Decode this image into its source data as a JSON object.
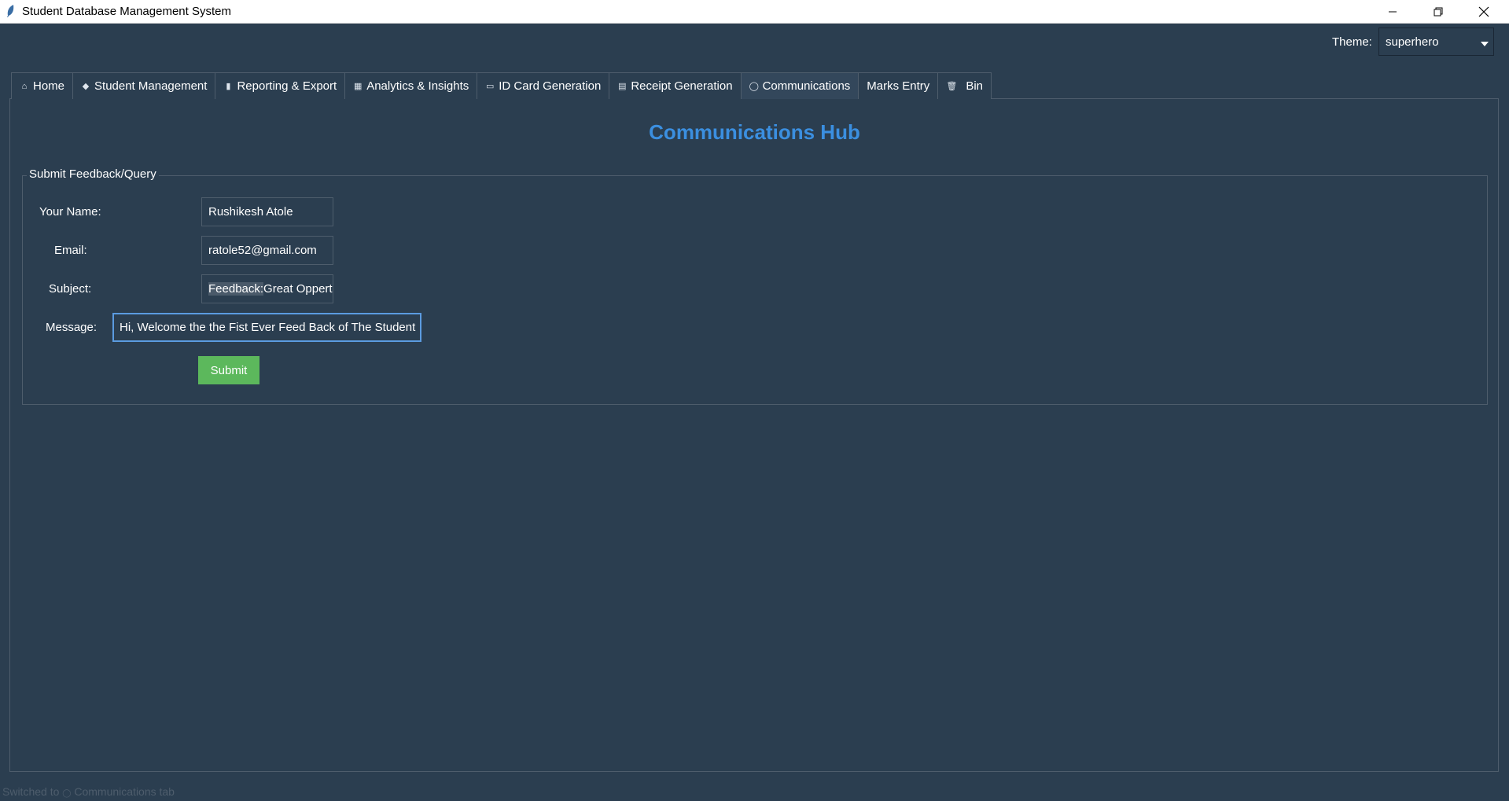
{
  "window": {
    "title": "Student Database Management System",
    "app_icon": "feather-icon"
  },
  "theme": {
    "label": "Theme:",
    "selected": "superhero"
  },
  "tabs": [
    {
      "icon": "⌂",
      "icon_name": "home-icon",
      "label": "Home"
    },
    {
      "icon": "◆",
      "icon_name": "graduation-cap-icon",
      "label": "Student Management"
    },
    {
      "icon": "▮",
      "icon_name": "chart-icon",
      "label": "Reporting & Export"
    },
    {
      "icon": "▦",
      "icon_name": "analytics-icon",
      "label": "Analytics & Insights"
    },
    {
      "icon": "▭",
      "icon_name": "id-card-icon",
      "label": "ID Card Generation"
    },
    {
      "icon": "▤",
      "icon_name": "receipt-icon",
      "label": "Receipt Generation"
    },
    {
      "icon": "◯",
      "icon_name": "speech-bubble-icon",
      "label": "Communications"
    },
    {
      "icon": "",
      "icon_name": "",
      "label": "Marks Entry"
    },
    {
      "icon": "🗑",
      "icon_name": "trash-icon",
      "label": "Bin"
    }
  ],
  "active_tab": "Communications",
  "main": {
    "heading": "Communications Hub",
    "group_label": "Submit Feedback/Query",
    "fields": {
      "name_label": "Your Name:",
      "name_value": "Rushikesh Atole",
      "email_label": "Email:",
      "email_value": "ratole52@gmail.com",
      "subject_label": "Subject:",
      "subject_selected": "Feedback:",
      "subject_rest": "Great Oppert",
      "message_label": "Message:",
      "message_value": "Hi, Welcome the the Fist Ever Feed Back of The Student "
    },
    "submit_label": "Submit"
  },
  "status_bar": {
    "prefix": "Switched to",
    "icon": "◯",
    "suffix": "Communications tab"
  },
  "colors": {
    "background": "#2b3e50",
    "heading": "#3b8fe0",
    "submit": "#5cb85c",
    "focus_border": "#5b9be0"
  }
}
